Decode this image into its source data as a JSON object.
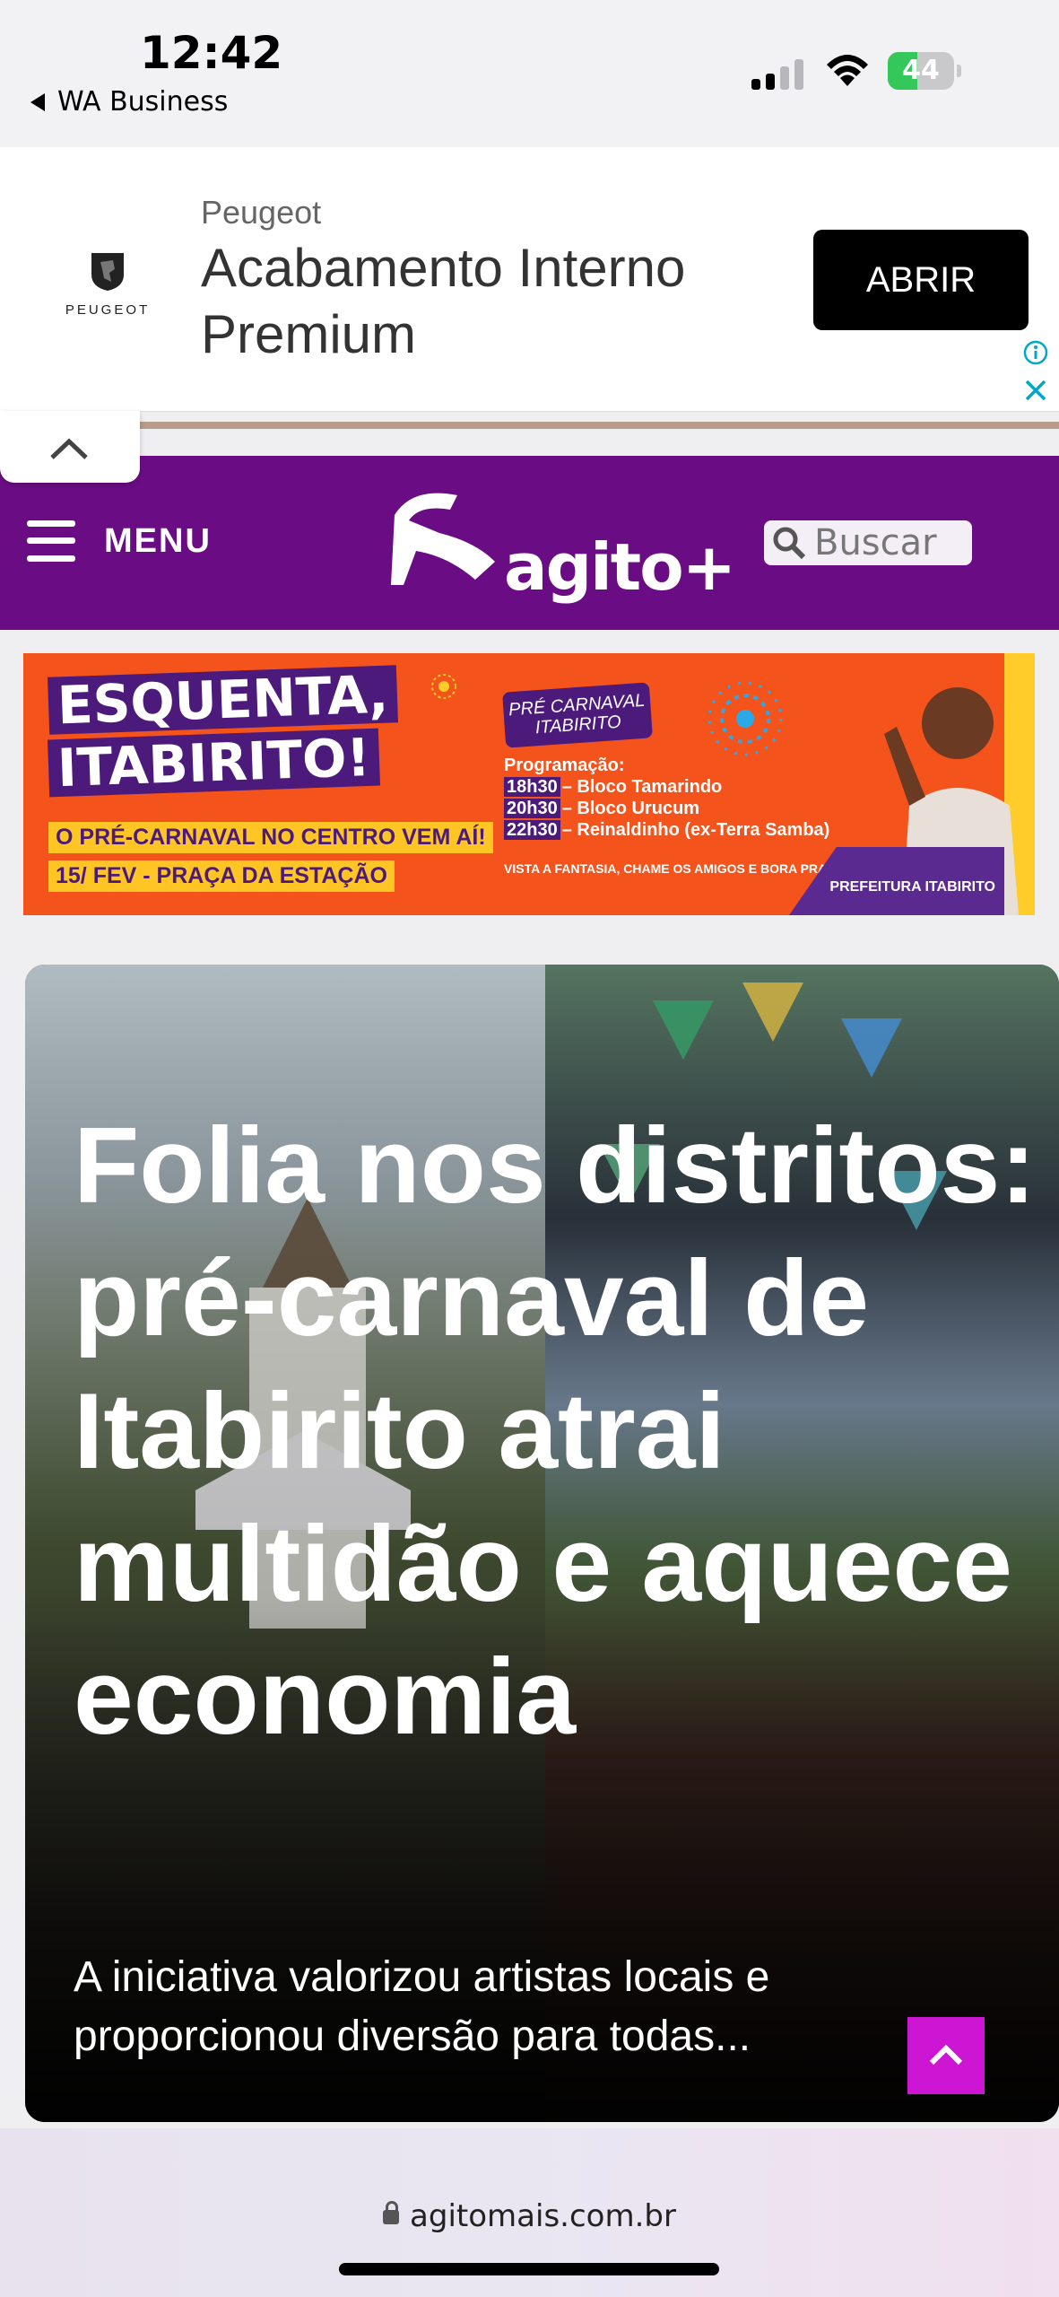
{
  "status_bar": {
    "time": "12:42",
    "back_app": "WA Business",
    "battery": "44",
    "battery_level": 0.44
  },
  "ad": {
    "logo_word": "PEUGEOT",
    "brand": "Peugeot",
    "title": "Acabamento Interno Premium",
    "cta": "ABRIR"
  },
  "header": {
    "menu_label": "MENU",
    "logo_text": "agito+",
    "search_placeholder": "Buscar",
    "bg_color": "#6a0d85"
  },
  "banner": {
    "title_line1": "ESQUENTA,",
    "title_line2": "ITABIRITO!",
    "sub_line1": "O PRÉ-CARNAVAL NO CENTRO VEM AÍ!",
    "sub_line2": "15/ FEV - PRAÇA DA ESTAÇÃO",
    "pre_badge": "PRÉ CARNAVAL ITABIRITO",
    "program_label": "Programação:",
    "program": [
      {
        "time": "18h30",
        "act": "– Bloco Tamarindo"
      },
      {
        "time": "20h30",
        "act": "– Bloco Urucum"
      },
      {
        "time": "22h30",
        "act": "– Reinaldinho (ex-Terra Samba)"
      }
    ],
    "footer": "VISTA A FANTASIA, CHAME OS AMIGOS E BORA PRA FOLIA!",
    "prefeitura": "PREFEITURA ITABIRITO"
  },
  "hero": {
    "title": "Folia nos distritos: pré-carnaval de Itabirito atrai multidão e aquece economia",
    "excerpt": "A iniciativa valorizou artistas locais e proporcionou diversão para todas..."
  },
  "browser": {
    "url": "agitomais.com.br"
  },
  "colors": {
    "accent": "#cc16d4",
    "header": "#6a0d85"
  }
}
